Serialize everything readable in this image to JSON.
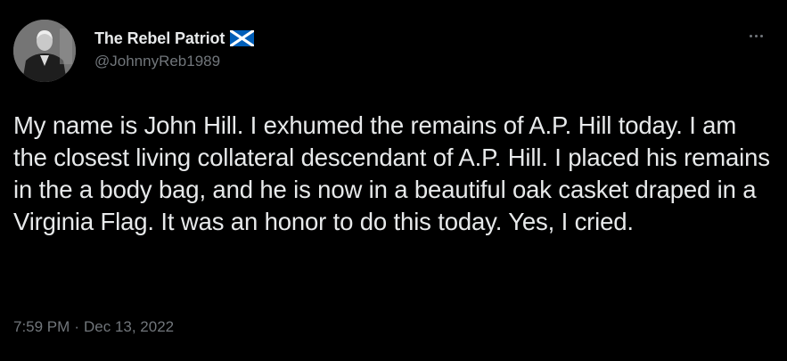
{
  "tweet": {
    "author": {
      "display_name": "The Rebel Patriot",
      "handle": "@JohnnyReb1989",
      "badge_icon": "scotland-flag-icon",
      "avatar": "author-avatar-photo"
    },
    "more_icon": "more-options-icon",
    "text": "My name is John Hill. I exhumed the remains of A.P. Hill today. I am the closest living collateral descendant of A.P. Hill. I placed his remains in the a body bag, and he is now in a beautiful oak casket draped in a Virginia Flag. It was an honor to do this today. Yes, I cried.",
    "time": "7:59 PM",
    "separator": "·",
    "date": "Dec 13, 2022"
  },
  "colors": {
    "background": "#000000",
    "primary_text": "#e7e9ea",
    "secondary_text": "#71767b",
    "flag_blue": "#005eb8",
    "flag_white": "#ffffff"
  }
}
